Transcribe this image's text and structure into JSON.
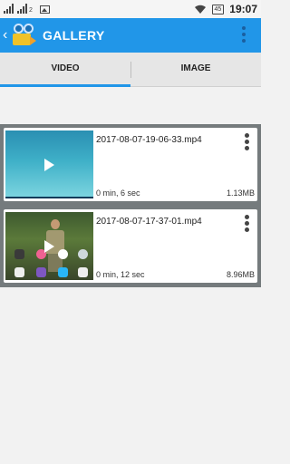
{
  "status_bar": {
    "battery": "45",
    "time": "19:07",
    "signal_sub": "2"
  },
  "app_bar": {
    "title": "GALLERY",
    "back_icon": "chevron-left-icon",
    "menu_icon": "more-vert-icon"
  },
  "tabs": [
    {
      "label": "VIDEO",
      "active": true
    },
    {
      "label": "IMAGE",
      "active": false
    }
  ],
  "videos": [
    {
      "file_name": "2017-08-07-19-06-33.mp4",
      "duration": "0 min, 6 sec",
      "size": "1.13MB"
    },
    {
      "file_name": "2017-08-07-17-37-01.mp4",
      "duration": "0 min, 12 sec",
      "size": "8.96MB"
    }
  ],
  "colors": {
    "accent": "#2196e8",
    "list_bg": "#757b7d"
  }
}
